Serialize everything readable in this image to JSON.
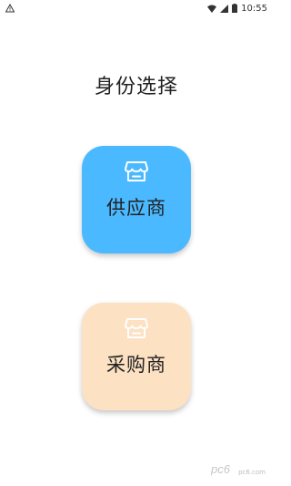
{
  "status_bar": {
    "time": "10:55",
    "icons": [
      "warning-icon",
      "wifi-icon",
      "signal-icon",
      "battery-icon"
    ]
  },
  "page": {
    "title": "身份选择"
  },
  "roles": [
    {
      "label": "供应商",
      "icon": "store-icon",
      "color": "#4BB9FF"
    },
    {
      "label": "采购商",
      "icon": "store-icon",
      "color": "#FCE1C3"
    }
  ],
  "watermark": {
    "text": "pc6.com"
  }
}
